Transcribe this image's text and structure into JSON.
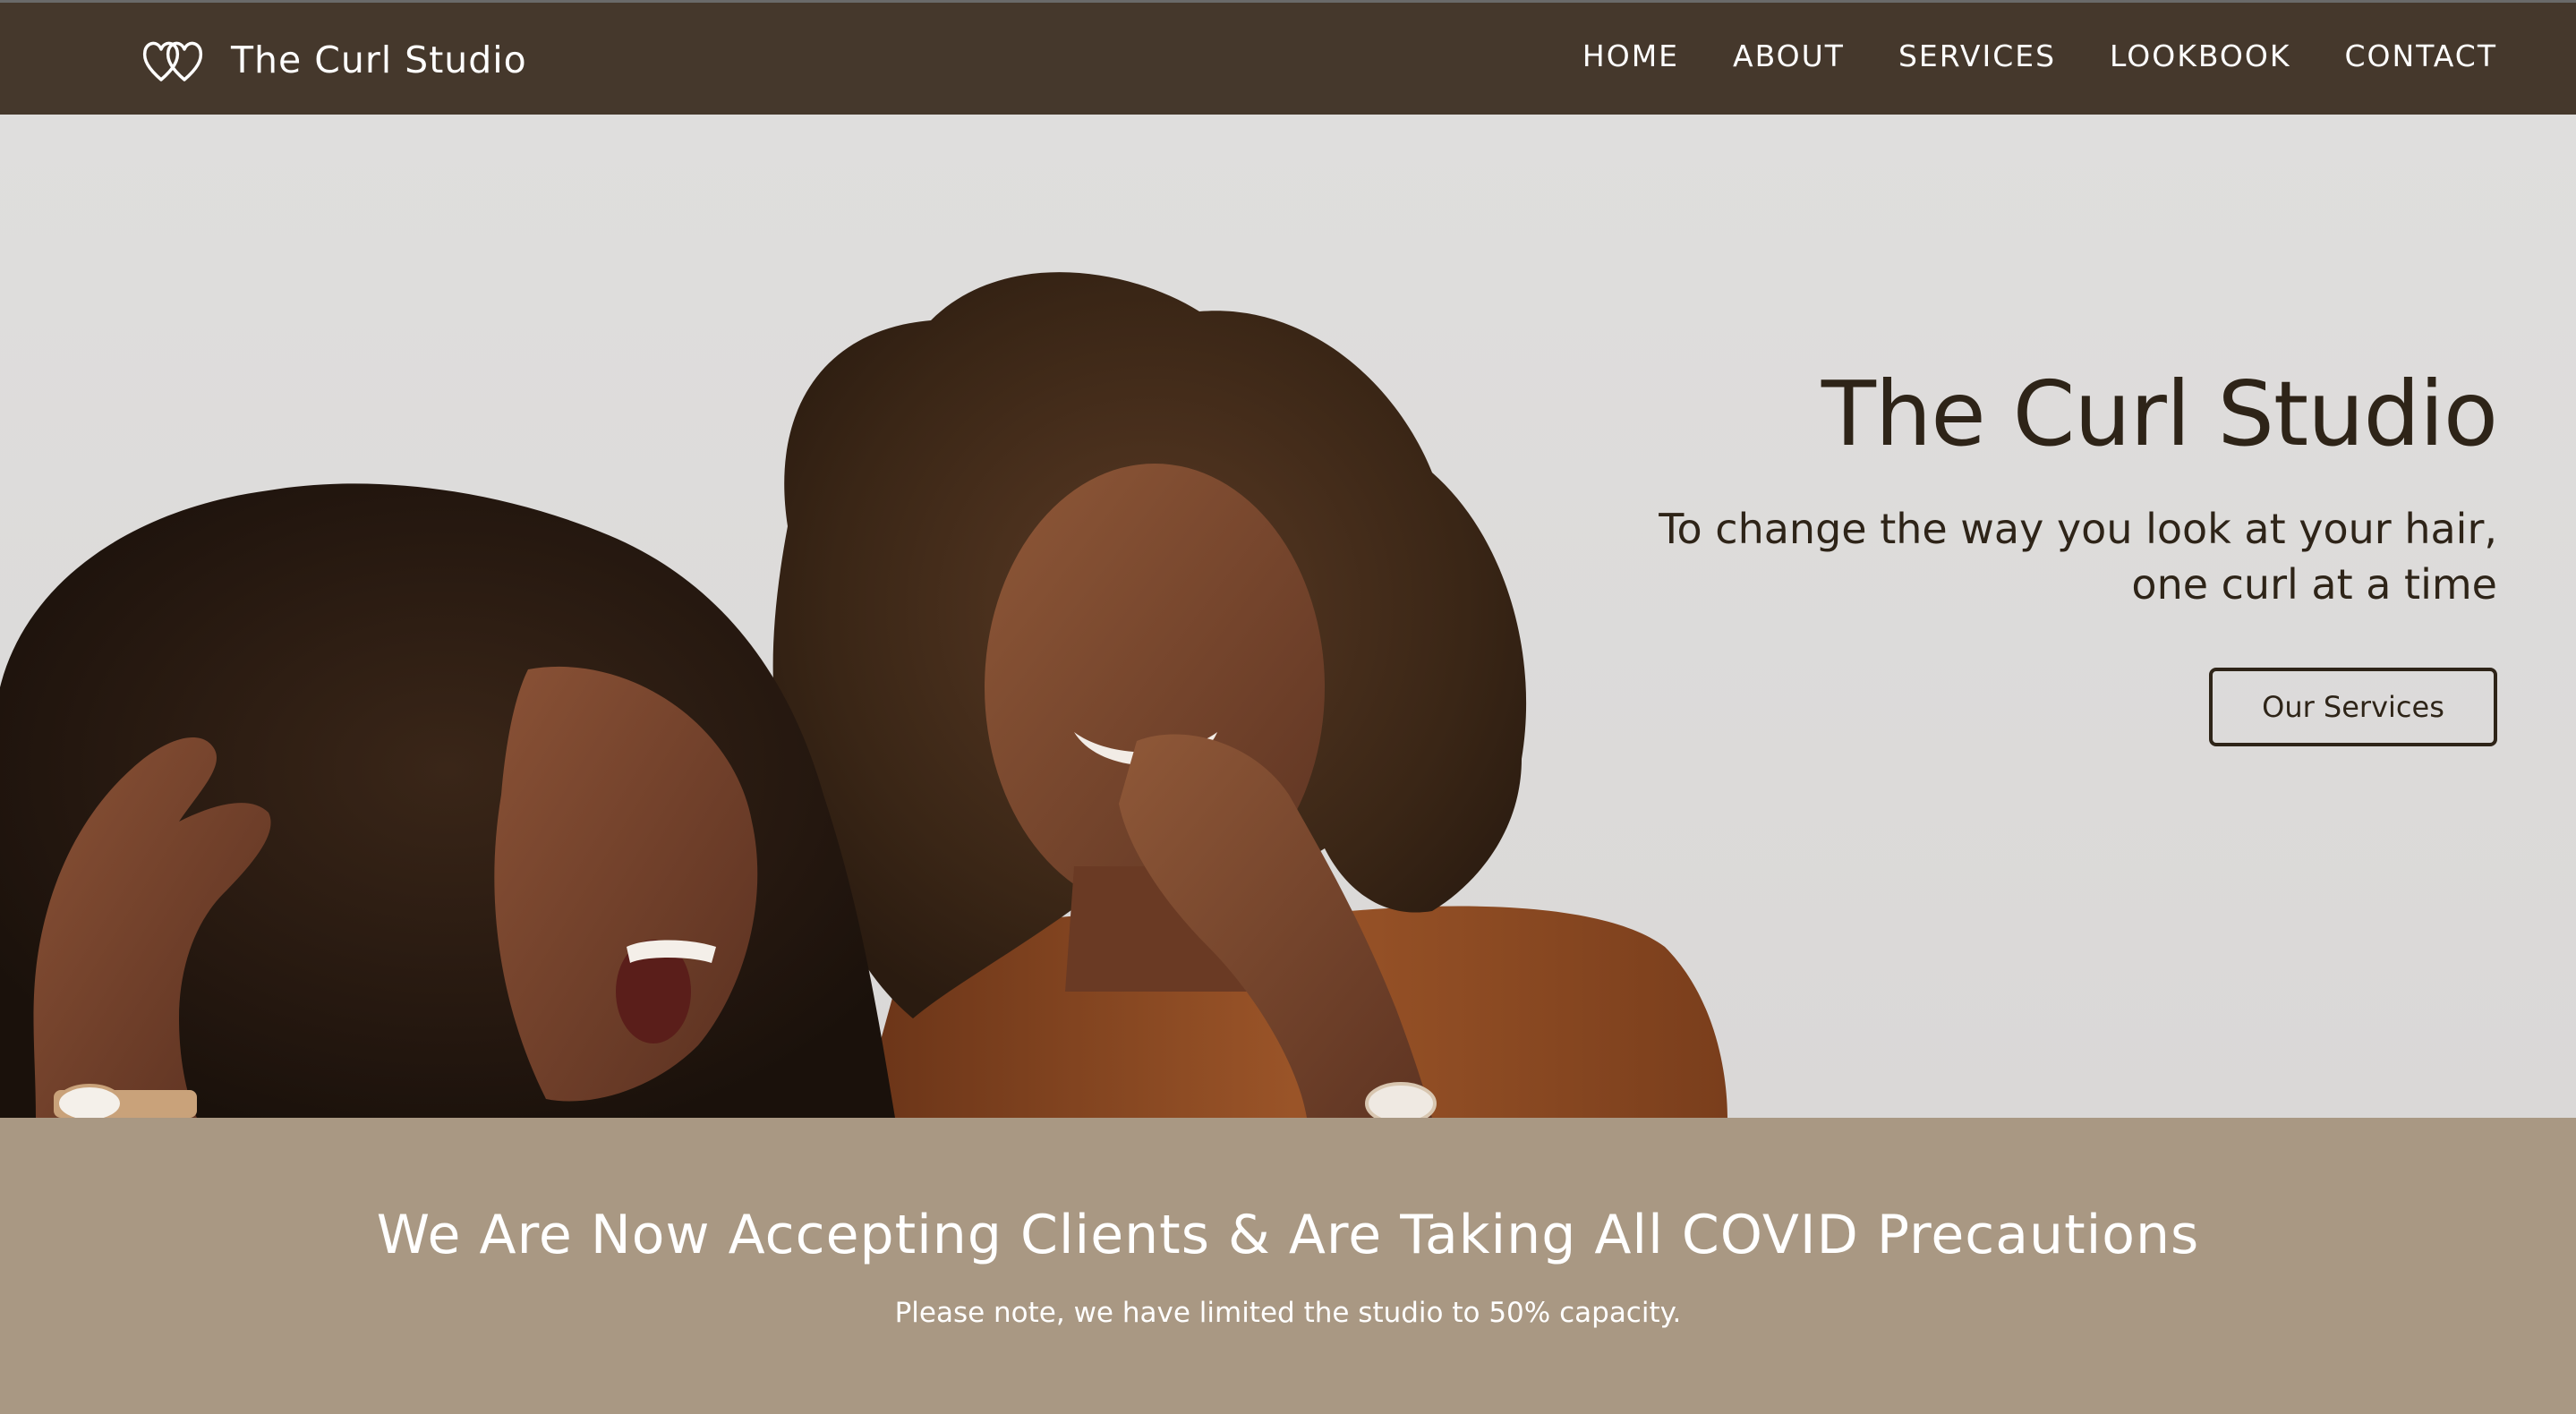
{
  "header": {
    "brand_name": "The Curl Studio",
    "logo_icon": "double-heart-icon",
    "nav": [
      {
        "label": "HOME"
      },
      {
        "label": "ABOUT"
      },
      {
        "label": "SERVICES"
      },
      {
        "label": "LOOKBOOK"
      },
      {
        "label": "CONTACT"
      }
    ]
  },
  "hero": {
    "title": "The Curl Studio",
    "tagline_line1": "To change the way you look at your hair,",
    "tagline_line2": "one curl at a time",
    "button_label": "Our Services"
  },
  "notice": {
    "title": "We Are Now Accepting Clients & Are Taking All COVID Precautions",
    "subtitle": "Please note, we have limited the studio to 50% capacity."
  },
  "colors": {
    "header_bg": "#45382c",
    "hero_bg": "#dcdad9",
    "text_dark": "#2e2418",
    "notice_bg": "#a99883",
    "white": "#ffffff"
  }
}
